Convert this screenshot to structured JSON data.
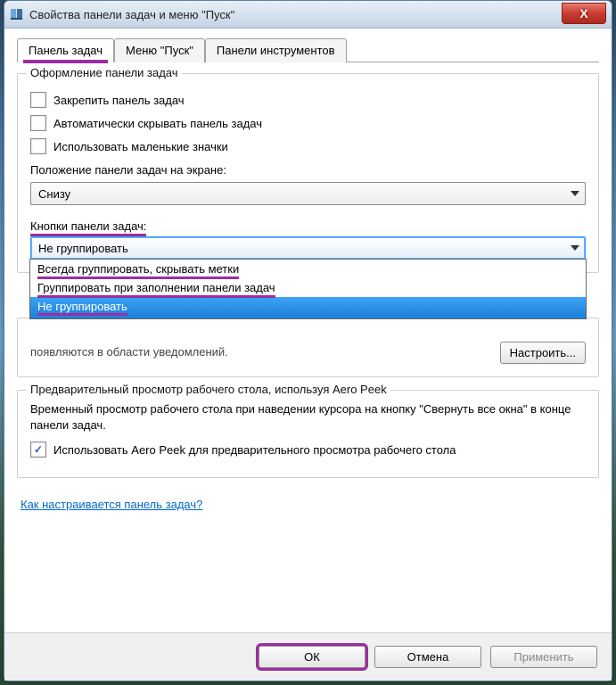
{
  "title": "Свойства панели задач и меню \"Пуск\"",
  "close_glyph": "X",
  "tabs": {
    "taskbar": "Панель задач",
    "start": "Меню \"Пуск\"",
    "toolbars": "Панели инструментов"
  },
  "group_appearance": {
    "legend": "Оформление панели задач",
    "lock": "Закрепить панель задач",
    "autohide": "Автоматически скрывать панель задач",
    "small": "Использовать маленькие значки",
    "pos_label": "Положение панели задач на экране:",
    "pos_value": "Снизу",
    "buttons_label": "Кнопки панели задач:",
    "buttons_value": "Не группировать",
    "options": {
      "always": "Всегда группировать, скрывать метки",
      "whenfull": "Группировать при заполнении панели задач",
      "never": "Не группировать"
    }
  },
  "notify": {
    "text": "появляются в области уведомлений.",
    "button": "Настроить..."
  },
  "aero": {
    "legend": "Предварительный просмотр рабочего стола, используя Aero Peek",
    "desc": "Временный просмотр рабочего стола при наведении курсора на кнопку \"Свернуть все окна\" в конце панели задач.",
    "chk": "Использовать Aero Peek для предварительного просмотра рабочего стола"
  },
  "help_link": "Как настраивается панель задач?",
  "buttons": {
    "ok": "ОК",
    "cancel": "Отмена",
    "apply": "Применить"
  }
}
